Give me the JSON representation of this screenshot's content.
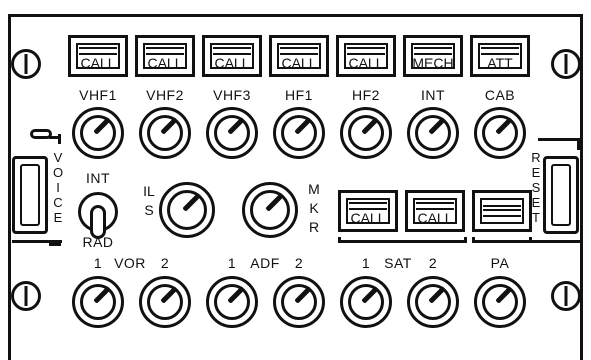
{
  "call_buttons": [
    {
      "label": "CALL",
      "id": "vhf1"
    },
    {
      "label": "CALL",
      "id": "vhf2"
    },
    {
      "label": "CALL",
      "id": "vhf3"
    },
    {
      "label": "CALL",
      "id": "hf1"
    },
    {
      "label": "CALL",
      "id": "hf2"
    },
    {
      "label": "MECH",
      "id": "int"
    },
    {
      "label": "ATT",
      "id": "cab"
    }
  ],
  "top_knob_labels": [
    "VHF1",
    "VHF2",
    "VHF3",
    "HF1",
    "HF2",
    "INT",
    "CAB"
  ],
  "side_left": {
    "letters": "VOICE"
  },
  "side_right": {
    "letters": "RESET"
  },
  "int_rad": {
    "int_label": "INT",
    "rad_label": "RAD"
  },
  "ils": {
    "letters": "ILS"
  },
  "mkr": {
    "letters": "MKR"
  },
  "mid_buttons": [
    {
      "label": "CALL"
    },
    {
      "label": "CALL"
    },
    {
      "label": ""
    }
  ],
  "bottom_labels": {
    "vor": {
      "one": "1",
      "name": "VOR",
      "two": "2"
    },
    "adf": {
      "one": "1",
      "name": "ADF",
      "two": "2"
    },
    "sat": {
      "one": "1",
      "name": "SAT",
      "two": "2"
    },
    "pa": {
      "name": "PA"
    }
  },
  "colors": {
    "ink": "#111111",
    "panel": "#ffffff"
  }
}
